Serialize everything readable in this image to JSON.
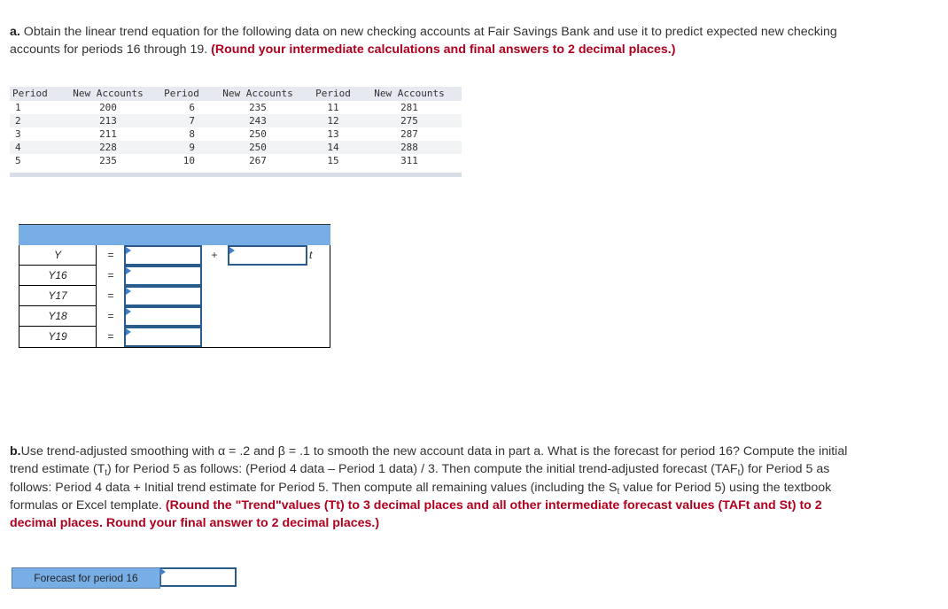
{
  "part_a": {
    "lead": "a.",
    "text": " Obtain the linear trend equation for the following data on new checking accounts at Fair Savings Bank and use it to predict expected new checking accounts for periods 16 through 19. ",
    "instruction": "(Round your intermediate calculations and final answers to 2 decimal places.)"
  },
  "data_table": {
    "headers": [
      "Period",
      "New Accounts",
      "Period",
      "New Accounts",
      "Period",
      "New Accounts"
    ],
    "rows": [
      [
        "1",
        "200",
        "6",
        "235",
        "11",
        "281"
      ],
      [
        "2",
        "213",
        "7",
        "243",
        "12",
        "275"
      ],
      [
        "3",
        "211",
        "8",
        "250",
        "13",
        "287"
      ],
      [
        "4",
        "228",
        "9",
        "250",
        "14",
        "288"
      ],
      [
        "5",
        "235",
        "10",
        "267",
        "15",
        "311"
      ]
    ]
  },
  "trend_table": {
    "equals": "=",
    "plus": "+",
    "t_var": "t",
    "rows": [
      {
        "label": "Y",
        "value": ""
      },
      {
        "label": "Y16",
        "value": ""
      },
      {
        "label": "Y17",
        "value": ""
      },
      {
        "label": "Y18",
        "value": ""
      },
      {
        "label": "Y19",
        "value": ""
      }
    ],
    "slope_value": ""
  },
  "part_b": {
    "lead": "b.",
    "s1": "Use trend-adjusted smoothing with α = .2 and β = .1 to smooth the new account data in part a. What is the forecast for period 16? Compute the initial trend estimate (T",
    "sub1": "t",
    "s2": ") for Period 5 as follows: (Period 4 data – Period 1 data) / 3. Then compute the initial trend-adjusted forecast (TAF",
    "sub2": "t",
    "s3": ") for Period 5 as follows: Period 4 data + Initial trend estimate for Period 5. Then compute all remaining values (including the S",
    "sub3": "t",
    "s4": " value for Period 5) using the textbook formulas or Excel template. ",
    "instruction": "(Round the \"Trend\"values (Tt) to 3 decimal places and all other intermediate forecast values (TAFt and St) to 2 decimal places.  Round your final answer to 2 decimal places.)"
  },
  "forecast": {
    "label": "Forecast for period 16",
    "value": ""
  },
  "colors": {
    "instruction_red": "#b0001e",
    "header_blue": "#78aee6",
    "input_border": "#2a5b8d"
  }
}
